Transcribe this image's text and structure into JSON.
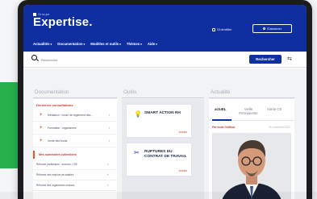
{
  "header": {
    "brand_small": "Groupe",
    "brand": "Expertise.",
    "login": "S'identifier",
    "subscribe": "S'abonner",
    "nav": [
      "Actualités",
      "Documentation",
      "Modèles et outils",
      "Thèmes",
      "Aide"
    ]
  },
  "search": {
    "placeholder": "Rechercher",
    "button": "Rechercher"
  },
  "documentation": {
    "title": "Documentation",
    "heading": "Dernières consultations",
    "items": [
      "Médiation : mode de règlement des...",
      "Formation : organismes",
      "Vente des fonds"
    ],
    "active": "Mes sommaires collections",
    "sub_items": [
      "Réforme paritarisme : accords, CSE",
      "Réforme des emplois de salariés",
      "Réforme des organismes sociaux"
    ]
  },
  "tools": {
    "title": "Outils",
    "cards": [
      {
        "name": "SMART ACTION RH",
        "more": "ACCÈS",
        "icon": "lightbulb-icon"
      },
      {
        "name": "RUPTURES DU CONTRAT DE TRAVAIL",
        "more": "ACCÈS",
        "icon": "crossed-tools-icon"
      }
    ]
  },
  "news": {
    "title": "Actualité",
    "tabs": [
      "actuEL",
      "Veille Permanente",
      "Alerte CE"
    ],
    "kicker": "Par toute l'édition",
    "date": "22 novembre 2023"
  },
  "colors": {
    "header_bg": "#0f2ea0",
    "accent_red": "#d0312d",
    "accent_orange": "#e3572b",
    "green_block": "#27b14c"
  }
}
